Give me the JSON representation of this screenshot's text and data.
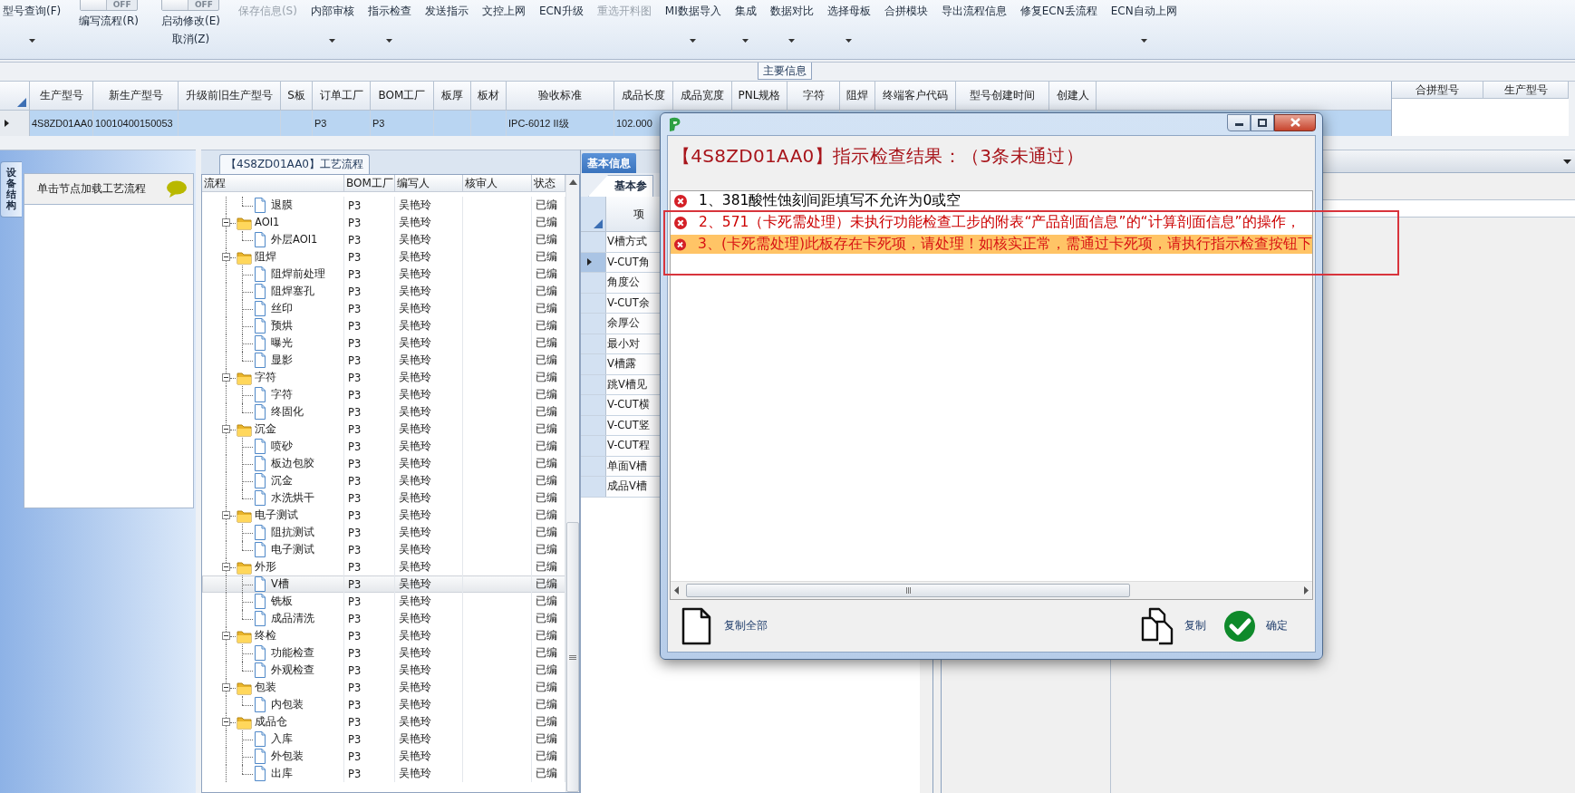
{
  "toolbar": {
    "items": [
      {
        "kind": "button",
        "label": "型号查询(F)",
        "menu": true,
        "disabled": false
      },
      {
        "kind": "toggle",
        "switch_text": "OFF",
        "on": false,
        "disabled": false,
        "labels": [
          "编写流程(R)"
        ]
      },
      {
        "kind": "toggle",
        "switch_text": "OFF",
        "on": false,
        "disabled": false,
        "labels": [
          "启动修改(E)",
          "取消(Z)"
        ]
      },
      {
        "kind": "button",
        "label": "保存信息(S)",
        "menu": false,
        "disabled": true
      },
      {
        "kind": "button",
        "label": "内部审核",
        "menu": true,
        "disabled": false
      },
      {
        "kind": "button",
        "label": "指示检查",
        "menu": true,
        "disabled": false
      },
      {
        "kind": "button",
        "label": "发送指示",
        "menu": false,
        "disabled": false
      },
      {
        "kind": "button",
        "label": "文控上网",
        "menu": false,
        "disabled": false
      },
      {
        "kind": "button",
        "label": "ECN升级",
        "menu": false,
        "disabled": false
      },
      {
        "kind": "button",
        "label": "重选开料图",
        "menu": false,
        "disabled": true
      },
      {
        "kind": "button",
        "label": "MI数据导入",
        "menu": true,
        "disabled": false
      },
      {
        "kind": "button",
        "label": "集成",
        "menu": true,
        "disabled": false
      },
      {
        "kind": "button",
        "label": "数据对比",
        "menu": true,
        "disabled": false
      },
      {
        "kind": "button",
        "label": "选择母板",
        "menu": true,
        "disabled": false
      },
      {
        "kind": "button",
        "label": "合拼模块",
        "menu": false,
        "disabled": false
      },
      {
        "kind": "button",
        "label": "导出流程信息",
        "menu": false,
        "disabled": false
      },
      {
        "kind": "button",
        "label": "修复ECN丢流程",
        "menu": false,
        "disabled": false
      },
      {
        "kind": "button",
        "label": "ECN自动上网",
        "menu": true,
        "disabled": false
      }
    ]
  },
  "main_info": {
    "group_title": "主要信息",
    "columns": [
      "生产型号",
      "新生产型号",
      "升级前旧生产型号",
      "S板",
      "订单工厂",
      "BOM工厂",
      "板厚",
      "板材",
      "验收标准",
      "成品长度",
      "成品宽度",
      "PNL规格",
      "字符",
      "阻焊",
      "终端客户代码",
      "型号创建时间",
      "创建人"
    ],
    "rows": [
      {
        "selected": true,
        "cells": [
          "4S8ZD01AA0",
          "10010400150053",
          "",
          "",
          "P3",
          "P3",
          "",
          "",
          "IPC-6012 II级",
          "102.000"
        ]
      }
    ],
    "side_columns": [
      "合拼型号",
      "生产型号"
    ]
  },
  "side": {
    "tab": "设备结构",
    "hint": "单击节点加载工艺流程"
  },
  "flow": {
    "title": "【4S8ZD01AA0】工艺流程",
    "columns": [
      "流程",
      "BOM工厂",
      "编写人",
      "核审人",
      "状态"
    ],
    "tree": [
      {
        "kind": "folder",
        "children": [
          {
            "kind": "step",
            "label": "退膜",
            "bom": "P3",
            "writer": "吴艳玲",
            "status": "已编",
            "selected": false
          }
        ]
      },
      {
        "kind": "folder",
        "label": "AOI1",
        "bom": "P3",
        "writer": "吴艳玲",
        "status": "已编",
        "selected": false,
        "expanded": true,
        "children": [
          {
            "kind": "step",
            "label": "外层AOI1",
            "bom": "P3",
            "writer": "吴艳玲",
            "status": "已编",
            "selected": false
          }
        ]
      },
      {
        "kind": "folder",
        "label": "阻焊",
        "bom": "P3",
        "writer": "吴艳玲",
        "status": "已编",
        "selected": false,
        "expanded": true,
        "children": [
          {
            "kind": "step",
            "label": "阻焊前处理",
            "bom": "P3",
            "writer": "吴艳玲",
            "status": "已编",
            "selected": false
          },
          {
            "kind": "step",
            "label": "阻焊塞孔",
            "bom": "P3",
            "writer": "吴艳玲",
            "status": "已编",
            "selected": false
          },
          {
            "kind": "step",
            "label": "丝印",
            "bom": "P3",
            "writer": "吴艳玲",
            "status": "已编",
            "selected": false
          },
          {
            "kind": "step",
            "label": "预烘",
            "bom": "P3",
            "writer": "吴艳玲",
            "status": "已编",
            "selected": false
          },
          {
            "kind": "step",
            "label": "曝光",
            "bom": "P3",
            "writer": "吴艳玲",
            "status": "已编",
            "selected": false
          },
          {
            "kind": "step",
            "label": "显影",
            "bom": "P3",
            "writer": "吴艳玲",
            "status": "已编",
            "selected": false
          }
        ]
      },
      {
        "kind": "folder",
        "label": "字符",
        "bom": "P3",
        "writer": "吴艳玲",
        "status": "已编",
        "selected": false,
        "expanded": true,
        "children": [
          {
            "kind": "step",
            "label": "字符",
            "bom": "P3",
            "writer": "吴艳玲",
            "status": "已编",
            "selected": false
          },
          {
            "kind": "step",
            "label": "终固化",
            "bom": "P3",
            "writer": "吴艳玲",
            "status": "已编",
            "selected": false
          }
        ]
      },
      {
        "kind": "folder",
        "label": "沉金",
        "bom": "P3",
        "writer": "吴艳玲",
        "status": "已编",
        "selected": false,
        "expanded": true,
        "children": [
          {
            "kind": "step",
            "label": "喷砂",
            "bom": "P3",
            "writer": "吴艳玲",
            "status": "已编",
            "selected": false
          },
          {
            "kind": "step",
            "label": "板边包胶",
            "bom": "P3",
            "writer": "吴艳玲",
            "status": "已编",
            "selected": false
          },
          {
            "kind": "step",
            "label": "沉金",
            "bom": "P3",
            "writer": "吴艳玲",
            "status": "已编",
            "selected": false
          },
          {
            "kind": "step",
            "label": "水洗烘干",
            "bom": "P3",
            "writer": "吴艳玲",
            "status": "已编",
            "selected": false
          }
        ]
      },
      {
        "kind": "folder",
        "label": "电子测试",
        "bom": "P3",
        "writer": "吴艳玲",
        "status": "已编",
        "selected": false,
        "expanded": true,
        "children": [
          {
            "kind": "step",
            "label": "阻抗测试",
            "bom": "P3",
            "writer": "吴艳玲",
            "status": "已编",
            "selected": false
          },
          {
            "kind": "step",
            "label": "电子测试",
            "bom": "P3",
            "writer": "吴艳玲",
            "status": "已编",
            "selected": false
          }
        ]
      },
      {
        "kind": "folder",
        "label": "外形",
        "bom": "P3",
        "writer": "吴艳玲",
        "status": "已编",
        "selected": false,
        "expanded": true,
        "children": [
          {
            "kind": "step",
            "label": "V槽",
            "bom": "P3",
            "writer": "吴艳玲",
            "status": "已编",
            "selected": true
          },
          {
            "kind": "step",
            "label": "铣板",
            "bom": "P3",
            "writer": "吴艳玲",
            "status": "已编",
            "selected": false
          },
          {
            "kind": "step",
            "label": "成品清洗",
            "bom": "P3",
            "writer": "吴艳玲",
            "status": "已编",
            "selected": false
          }
        ]
      },
      {
        "kind": "folder",
        "label": "终检",
        "bom": "P3",
        "writer": "吴艳玲",
        "status": "已编",
        "selected": false,
        "expanded": true,
        "children": [
          {
            "kind": "step",
            "label": "功能检查",
            "bom": "P3",
            "writer": "吴艳玲",
            "status": "已编",
            "selected": false
          },
          {
            "kind": "step",
            "label": "外观检查",
            "bom": "P3",
            "writer": "吴艳玲",
            "status": "已编",
            "selected": false
          }
        ]
      },
      {
        "kind": "folder",
        "label": "包装",
        "bom": "P3",
        "writer": "吴艳玲",
        "status": "已编",
        "selected": false,
        "expanded": true,
        "children": [
          {
            "kind": "step",
            "label": "内包装",
            "bom": "P3",
            "writer": "吴艳玲",
            "status": "已编",
            "selected": false
          }
        ]
      },
      {
        "kind": "folder",
        "label": "成品仓",
        "bom": "P3",
        "writer": "吴艳玲",
        "status": "已编",
        "selected": false,
        "expanded": true,
        "children": [
          {
            "kind": "step",
            "label": "入库",
            "bom": "P3",
            "writer": "吴艳玲",
            "status": "已编",
            "selected": false
          },
          {
            "kind": "step",
            "label": "外包装",
            "bom": "P3",
            "writer": "吴艳玲",
            "status": "已编",
            "selected": false
          },
          {
            "kind": "step",
            "label": "出库",
            "bom": "P3",
            "writer": "吴艳玲",
            "status": "已编",
            "selected": false
          }
        ]
      }
    ]
  },
  "basic": {
    "tabs": [
      {
        "label": "基本信息",
        "selected": true
      }
    ],
    "subtabs": [
      {
        "label": "基本参",
        "selected": true
      }
    ],
    "column": "项",
    "rows": [
      {
        "label": "V槽方式",
        "selected": false
      },
      {
        "label": "V-CUT角",
        "selected": true
      },
      {
        "label": "角度公",
        "selected": false
      },
      {
        "label": "V-CUT余",
        "selected": false
      },
      {
        "label": "余厚公",
        "selected": false
      },
      {
        "label": "最小对",
        "selected": false
      },
      {
        "label": "V槽露",
        "selected": false
      },
      {
        "label": "跳V槽见",
        "selected": false
      },
      {
        "label": "V-CUT横",
        "selected": false
      },
      {
        "label": "V-CUT竖",
        "selected": false
      },
      {
        "label": "V-CUT程",
        "selected": false
      },
      {
        "label": "单面V槽",
        "selected": false
      },
      {
        "label": "成品V槽",
        "selected": false
      }
    ]
  },
  "dialog": {
    "heading": "【4S8ZD01AA0】指示检查结果：（3条未通过）",
    "results": [
      {
        "kind": "plain",
        "text": "1、381酸性蚀刻间距填写不允许为0或空",
        "selected": false
      },
      {
        "text": "2、571（卡死需处理）未执行功能检查工步的附表“产品剖面信息”的“计算剖面信息”的操作，",
        "kind": "error",
        "selected": false
      },
      {
        "text": "3、(卡死需处理)此板存在卡死项，请处理！如核实正常，需通过卡死项，请执行指示检查按钮下",
        "kind": "error",
        "selected": true
      }
    ],
    "buttons": [
      {
        "kind": "copy_all",
        "label": "复制全部"
      },
      {
        "kind": "copy",
        "label": "复制"
      },
      {
        "kind": "ok",
        "label": "确定"
      }
    ]
  }
}
